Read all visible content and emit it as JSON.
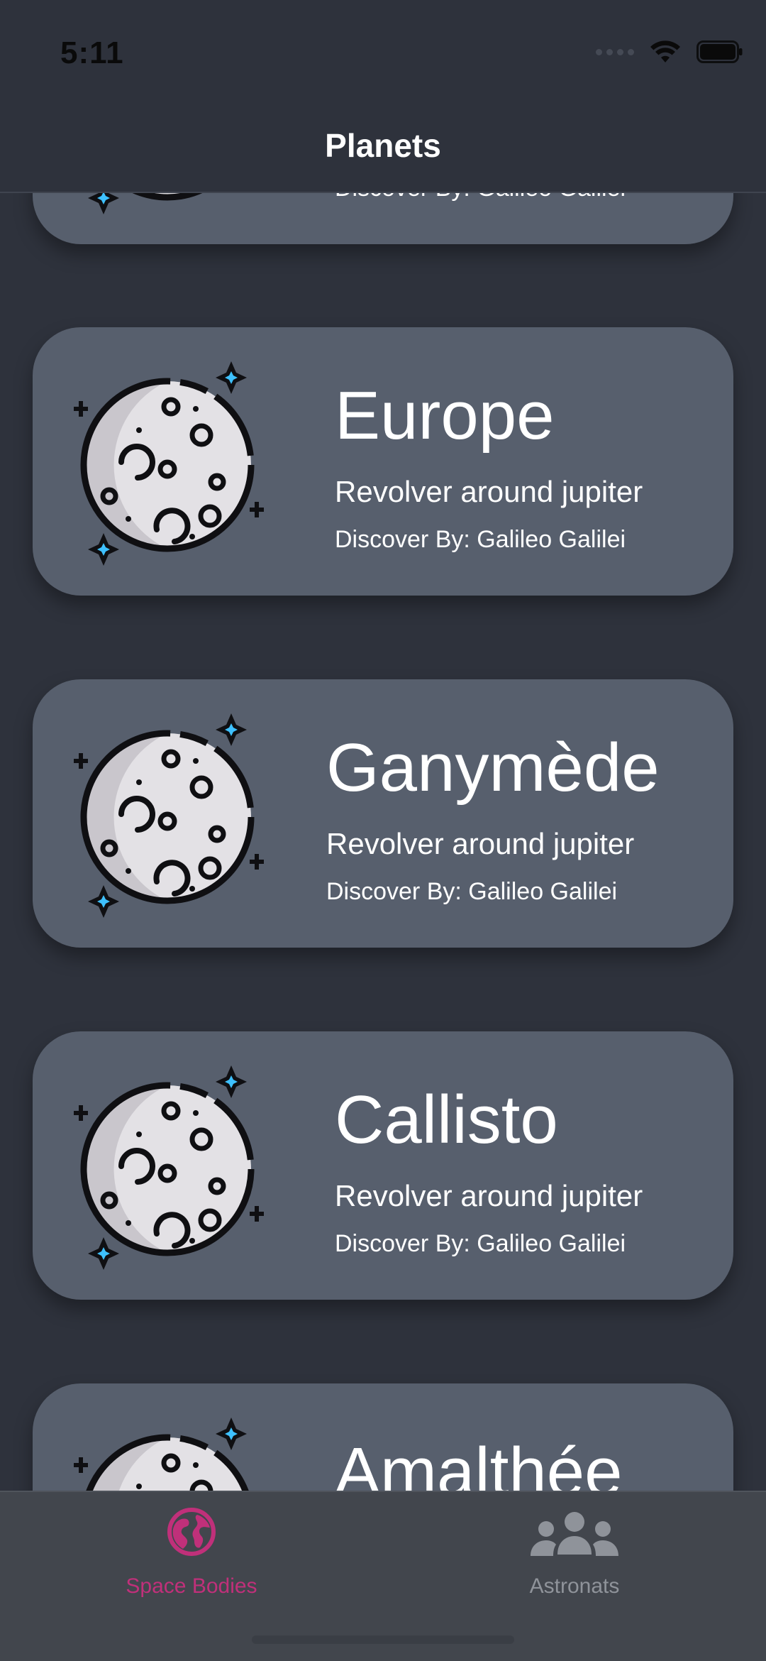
{
  "status_bar": {
    "time": "5:11"
  },
  "header": {
    "title": "Planets"
  },
  "cards": [
    {
      "name": "",
      "orbit": "",
      "discovered": "Discover By: Galileo Galilei"
    },
    {
      "name": "Europe",
      "orbit": "Revolver around jupiter",
      "discovered": "Discover By: Galileo Galilei"
    },
    {
      "name": "Ganymède",
      "orbit": "Revolver around jupiter",
      "discovered": "Discover By: Galileo Galilei"
    },
    {
      "name": "Callisto",
      "orbit": "Revolver around jupiter",
      "discovered": "Discover By: Galileo Galilei"
    },
    {
      "name": "Amalthée",
      "orbit": "",
      "discovered": ""
    }
  ],
  "tab_bar": {
    "tabs": [
      {
        "label": "Space Bodies",
        "icon": "globe-icon",
        "active": true
      },
      {
        "label": "Astronats",
        "icon": "people-group-icon",
        "active": false
      }
    ],
    "active_color": "#c0307a",
    "inactive_color": "#8f939a"
  },
  "colors": {
    "background": "#2e323c",
    "card": "#575f6d",
    "tab_bar": "#42464d"
  }
}
